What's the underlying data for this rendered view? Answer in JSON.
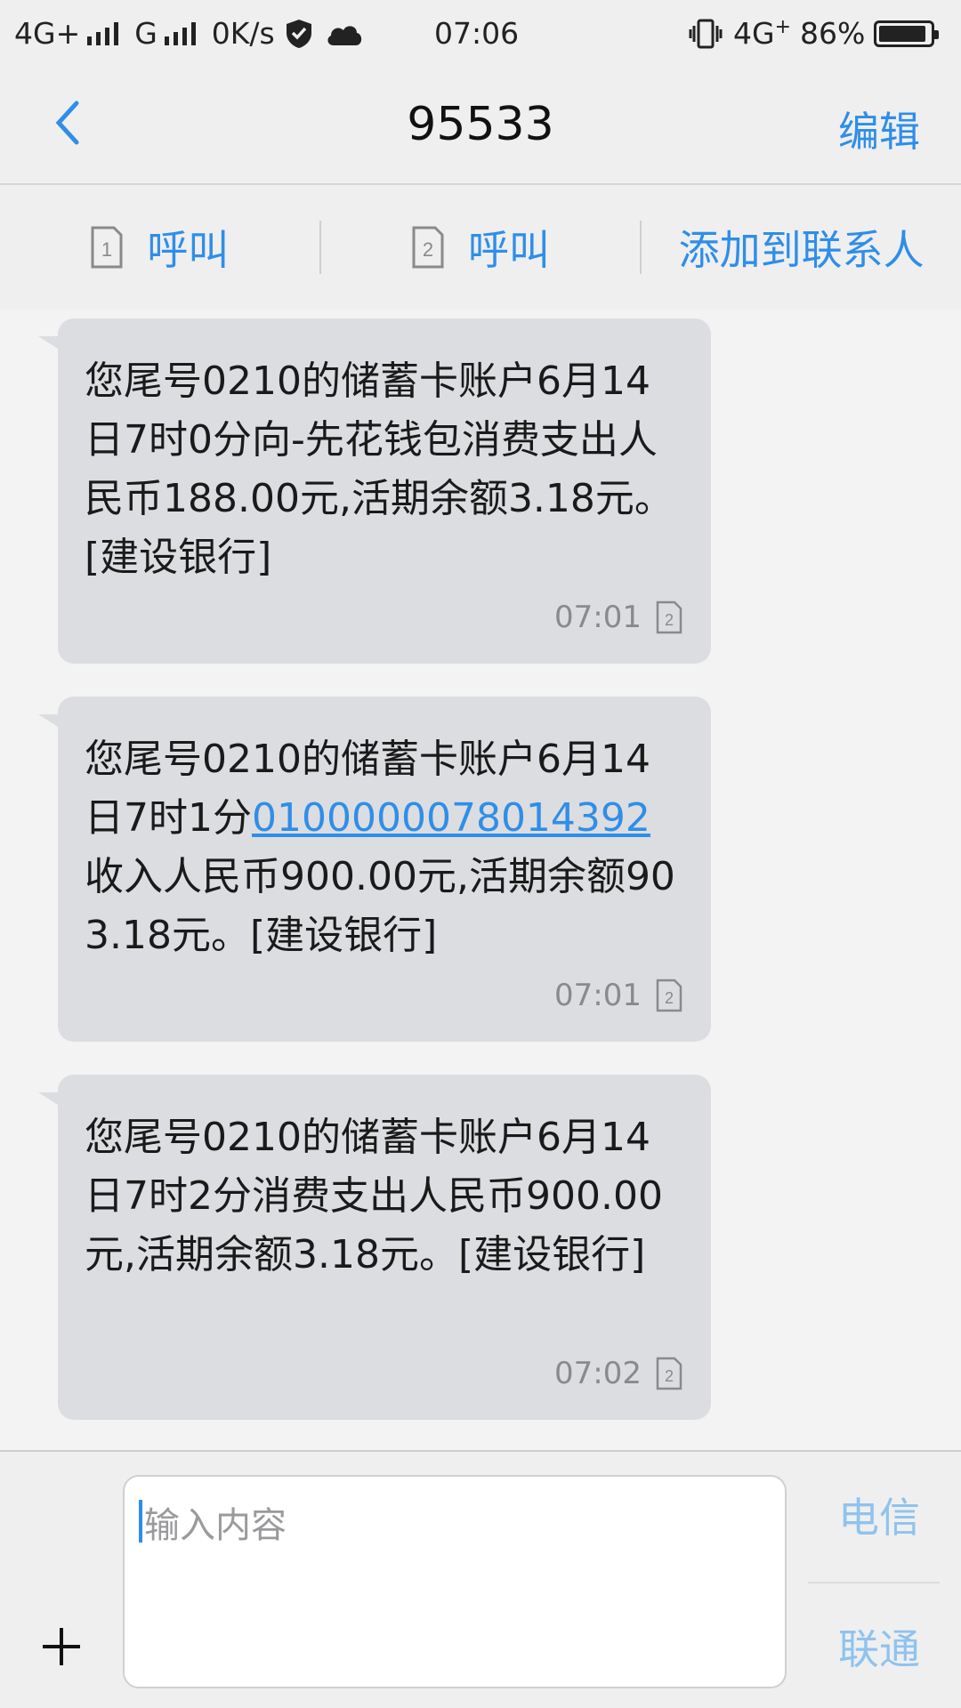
{
  "status_bar": {
    "network1": "4G+",
    "network2": "G",
    "speed": "0K/s",
    "time": "07:06",
    "network3": "4G",
    "battery": "86%",
    "icons": [
      "shield-icon",
      "cloud-icon",
      "vibrate-icon",
      "battery-icon"
    ]
  },
  "header": {
    "title": "95533",
    "edit_label": "编辑"
  },
  "actions": {
    "call1_label": "呼叫",
    "call1_sim": "1",
    "call2_label": "呼叫",
    "call2_sim": "2",
    "add_contact_label": "添加到联系人"
  },
  "messages": [
    {
      "text_parts": [
        "您尾号0210的储蓄卡账户6月14日7时0分向-先花钱包消费支出人民币188.00元,活期余额3.18元。[建设银行]"
      ],
      "time": "07:01",
      "sim": "2"
    },
    {
      "text_before": "您尾号0210的储蓄卡账户6月14日7时1分",
      "link": "0100000078014392",
      "text_after": "收入人民币900.00元,活期余额903.18元。[建设银行]",
      "time": "07:01",
      "sim": "2"
    },
    {
      "text_parts": [
        "您尾号0210的储蓄卡账户6月14日7时2分消费支出人民币900.00元,活期余额3.18元。[建设银行]"
      ],
      "time": "07:02",
      "sim": "2"
    }
  ],
  "input": {
    "placeholder": "输入内容",
    "send_telecom": "电信",
    "send_unicom": "联通"
  },
  "colors": {
    "accent": "#2f8ee8",
    "bubble": "#dcdde0",
    "send_disabled": "#8fc3ee"
  }
}
